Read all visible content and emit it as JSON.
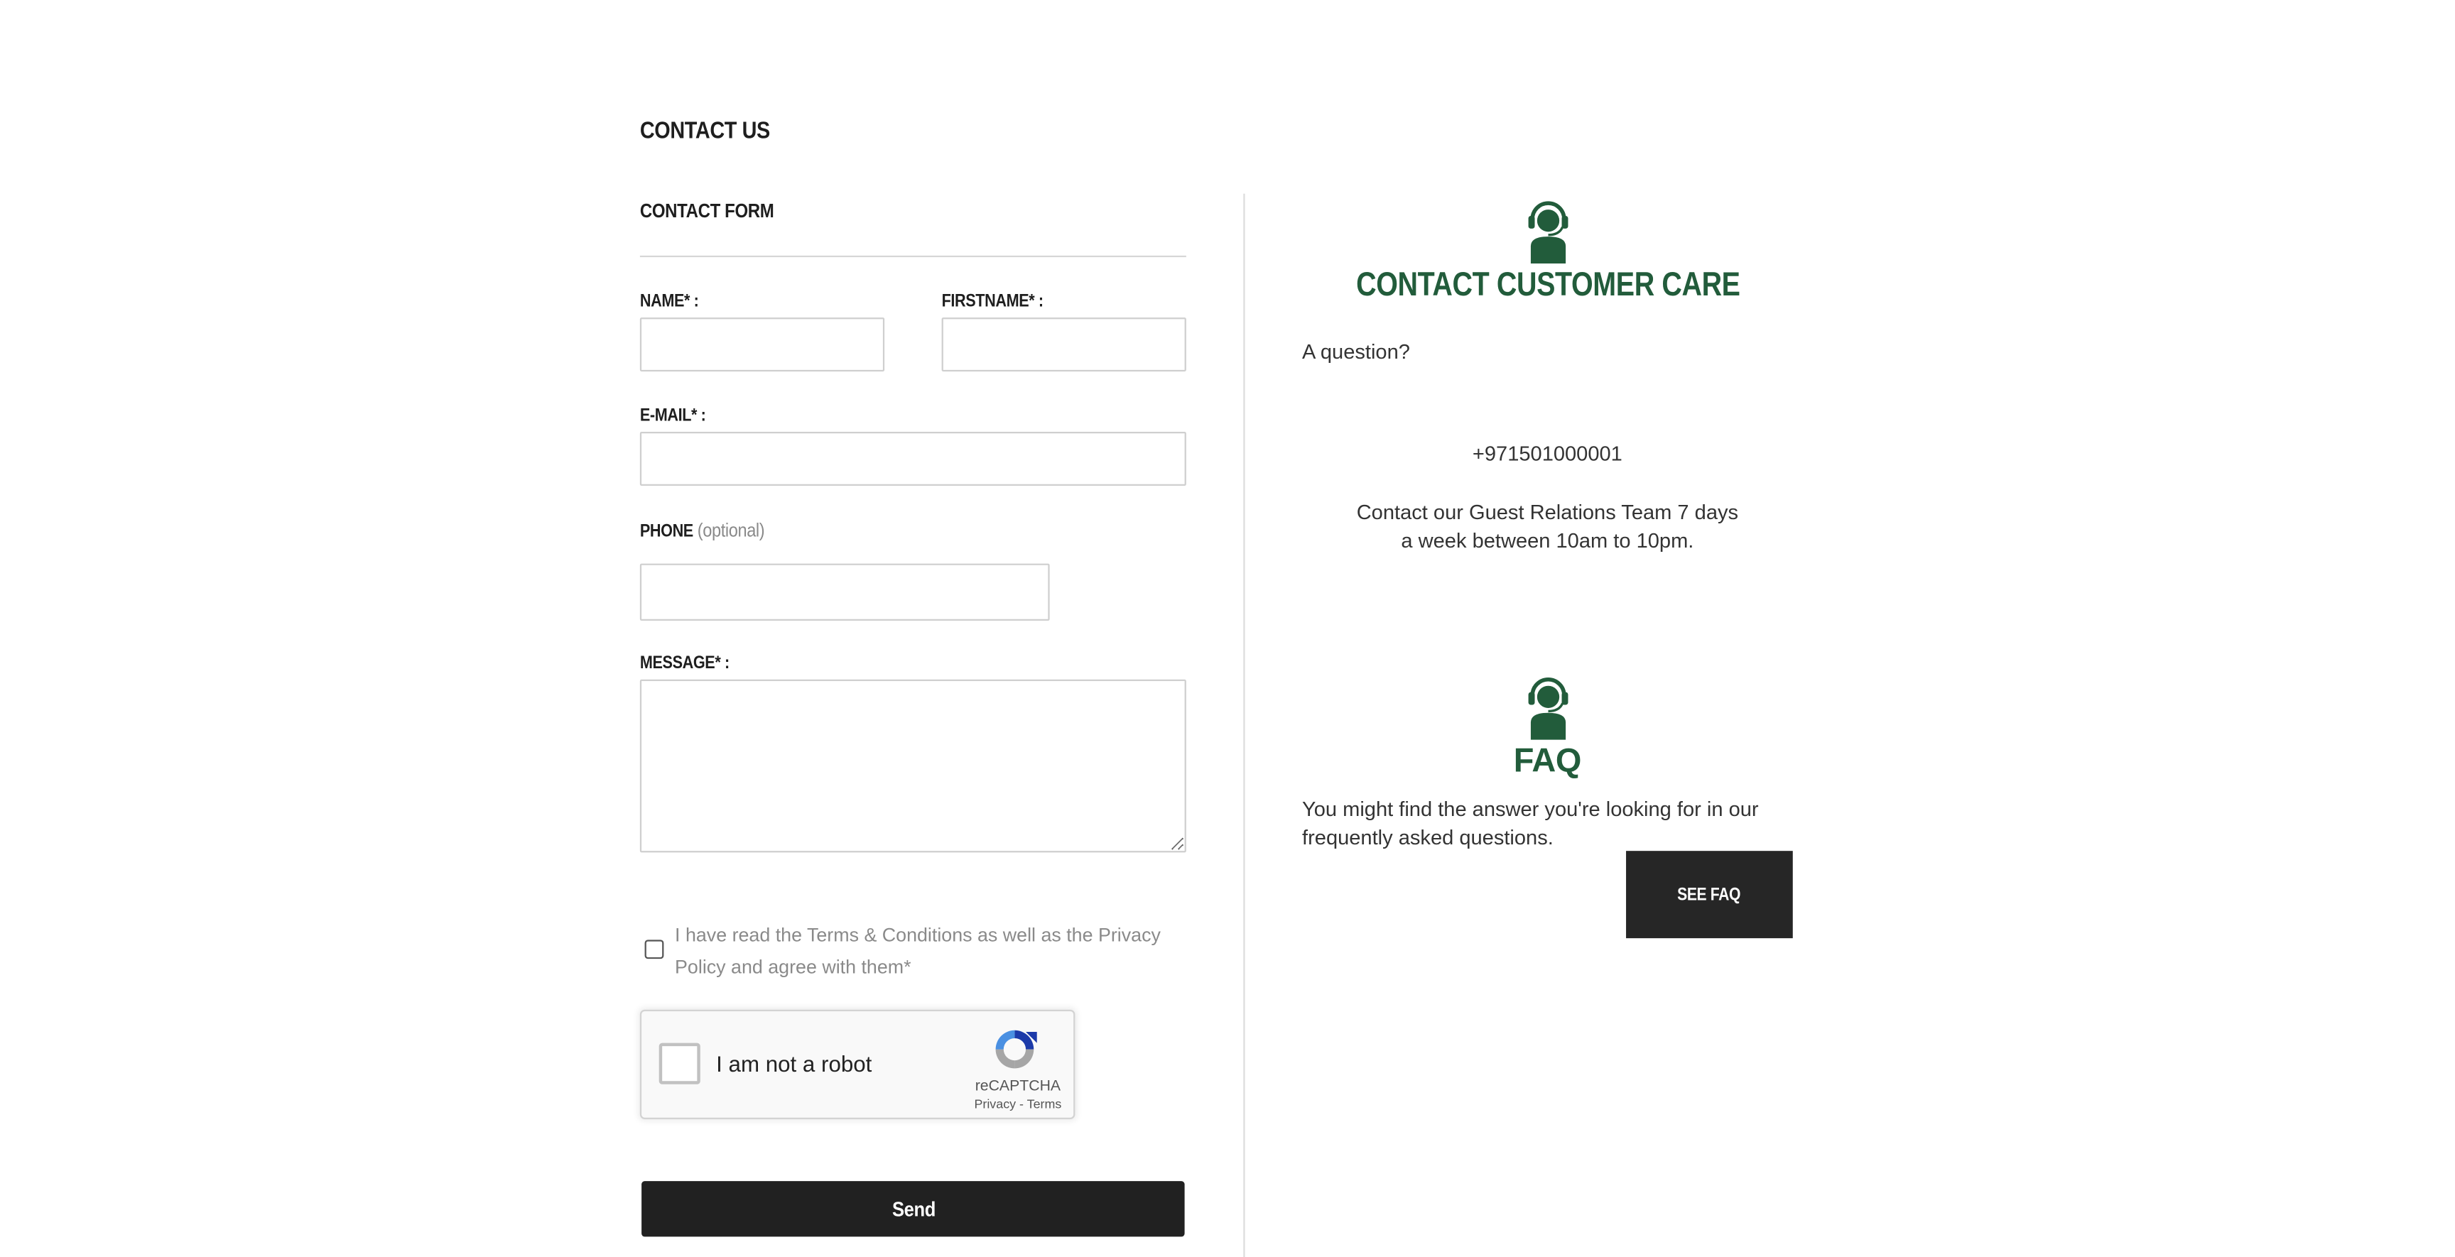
{
  "page": {
    "title": "CONTACT US"
  },
  "form": {
    "title": "CONTACT FORM",
    "name_label": "NAME* :",
    "firstname_label": "FIRSTNAME* :",
    "email_label": "E-MAIL* :",
    "phone_label": "PHONE",
    "phone_optional": "(optional)",
    "message_label": "MESSAGE* :",
    "name_value": "",
    "firstname_value": "",
    "email_value": "",
    "phone_value": "",
    "message_value": "",
    "agree_text": "I have read the Terms & Conditions as well as the Privacy Policy and agree with them*",
    "send_label": "Send"
  },
  "captcha": {
    "label": "I am not a robot",
    "brand": "reCAPTCHA",
    "links": "Privacy - Terms"
  },
  "care": {
    "title": "CONTACT CUSTOMER CARE",
    "question": "A question?",
    "phone": "+971501000001",
    "hours": "Contact our Guest Relations Team 7 days a week between 10am to 10pm."
  },
  "faq": {
    "title": "FAQ",
    "text": "You might find the answer you're looking for in our frequently asked questions.",
    "button_label": "SEE FAQ"
  },
  "colors": {
    "accent_green": "#225c3b",
    "button_dark": "#212121",
    "icon": "agent-headset-icon"
  }
}
